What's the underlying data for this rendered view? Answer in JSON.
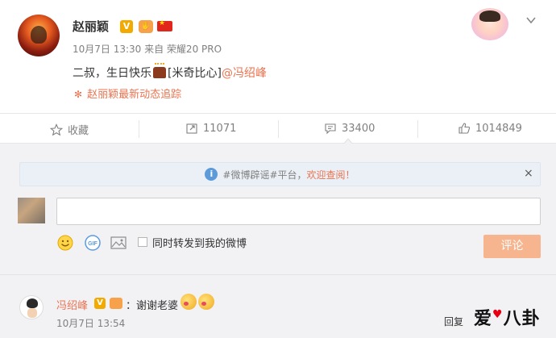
{
  "post": {
    "author": "赵丽颖",
    "verified_badge": "V",
    "meta": "10月7日 13:30 来自 荣耀20 PRO",
    "content_prefix": "二叔，生日快乐",
    "content_emoji_text": "[米奇比心]",
    "content_mention": "@冯绍峰",
    "tracker_label": "赵丽颖最新动态追踪",
    "tracker_icon": "pinwheel-icon"
  },
  "actions": {
    "favorite_label": "收藏",
    "repost_count": "11071",
    "comment_count": "33400",
    "like_count": "1014849"
  },
  "comment_box": {
    "notice_prefix": "#微博辟谣#平台，",
    "notice_highlight": "欢迎查阅！",
    "notice_close": "×",
    "repost_checkbox_label": "同时转发到我的微博",
    "submit_label": "评论"
  },
  "reply": {
    "name": "冯绍峰",
    "verified_badge": "V",
    "text": "：谢谢老婆",
    "time": "10月7日 13:54",
    "reply_label": "回复"
  },
  "watermark": {
    "text_1": "爱",
    "text_2": "八卦"
  },
  "colors": {
    "accent": "#eb7350",
    "gold": "#f2a900",
    "comment_bg": "#f2f2f5"
  }
}
